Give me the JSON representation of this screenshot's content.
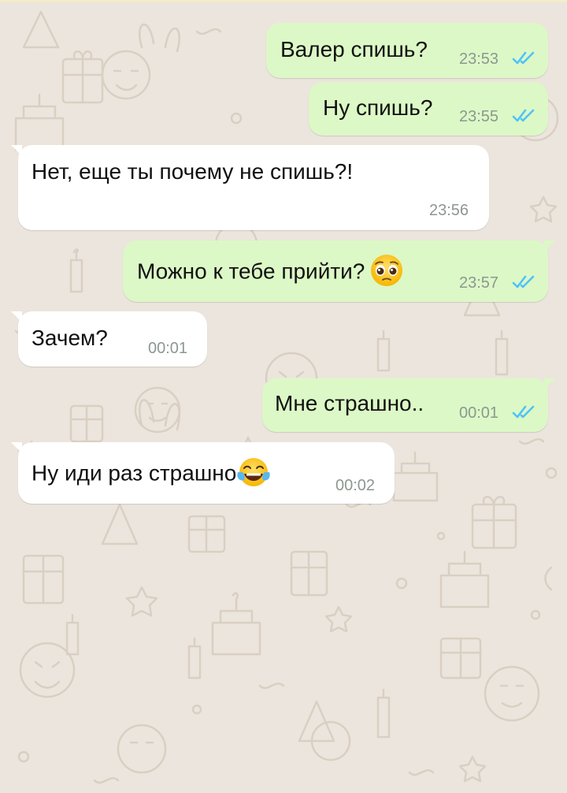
{
  "messages": [
    {
      "dir": "out",
      "text": "Валер спишь?",
      "time": "23:53",
      "read": true
    },
    {
      "dir": "out",
      "text": "Ну спишь?",
      "time": "23:55",
      "read": true
    },
    {
      "dir": "in",
      "text": "Нет, еще ты почему не спишь?!",
      "time": "23:56"
    },
    {
      "dir": "out",
      "text": "Можно к тебе прийти?",
      "emoji": "pleading-face",
      "time": "23:57",
      "read": true
    },
    {
      "dir": "in",
      "text": "Зачем?",
      "time": "00:01"
    },
    {
      "dir": "out",
      "text": "Мне страшно..",
      "time": "00:01",
      "read": true
    },
    {
      "dir": "in",
      "text": "Ну иди раз страшно",
      "emoji": "tears-of-joy-face",
      "time": "00:02"
    }
  ],
  "colors": {
    "wallpaper": "#ece5dd",
    "outgoing_bubble": "#dcf8c6",
    "incoming_bubble": "#ffffff",
    "read_ticks": "#4fc3f7",
    "timestamp": "#8c9891"
  }
}
